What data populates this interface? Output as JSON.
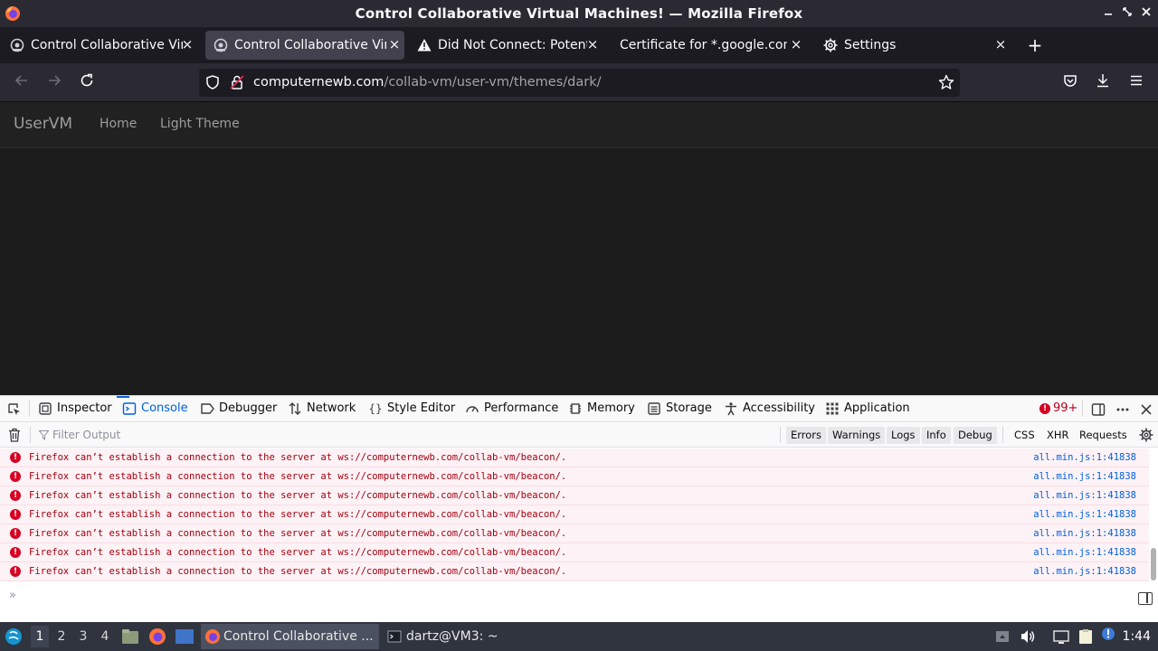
{
  "window": {
    "title": "Control Collaborative Virtual Machines! — Mozilla Firefox",
    "controls": [
      "minimize",
      "maximize",
      "close"
    ]
  },
  "tabs": [
    {
      "label": "Control Collaborative Virtual Machines!",
      "icon": "vm-favicon-icon",
      "selected": false
    },
    {
      "label": "Control Collaborative Virtual Machines!",
      "icon": "vm-favicon-icon",
      "selected": true
    },
    {
      "label": "Did Not Connect: Potential Security Issue",
      "icon": "warning-icon",
      "selected": false
    },
    {
      "label": "Certificate for *.google.com",
      "icon": "none",
      "selected": false
    },
    {
      "label": "Settings",
      "icon": "gear-icon",
      "selected": false
    }
  ],
  "navbar": {
    "url_host": "computernewb.com",
    "url_path": "/collab-vm/user-vm/themes/dark/"
  },
  "site": {
    "brand": "UserVM",
    "links": [
      "Home",
      "Light Theme"
    ]
  },
  "devtools": {
    "tabs": [
      {
        "label": "Inspector",
        "icon": "inspector-icon"
      },
      {
        "label": "Console",
        "icon": "console-icon",
        "active": true
      },
      {
        "label": "Debugger",
        "icon": "debugger-icon"
      },
      {
        "label": "Network",
        "icon": "network-icon"
      },
      {
        "label": "Style Editor",
        "icon": "style-editor-icon"
      },
      {
        "label": "Performance",
        "icon": "performance-icon"
      },
      {
        "label": "Memory",
        "icon": "memory-icon"
      },
      {
        "label": "Storage",
        "icon": "storage-icon"
      },
      {
        "label": "Accessibility",
        "icon": "accessibility-icon"
      },
      {
        "label": "Application",
        "icon": "application-icon"
      }
    ],
    "error_count": "99+",
    "filter_placeholder": "Filter Output",
    "level_filters": [
      "Errors",
      "Warnings",
      "Logs",
      "Info",
      "Debug"
    ],
    "type_filters": [
      "CSS",
      "XHR",
      "Requests"
    ],
    "messages": [
      {
        "text": "Firefox can’t establish a connection to the server at ws://computernewb.com/collab-vm/beacon/.",
        "source": "all.min.js:1:41838"
      },
      {
        "text": "Firefox can’t establish a connection to the server at ws://computernewb.com/collab-vm/beacon/.",
        "source": "all.min.js:1:41838"
      },
      {
        "text": "Firefox can’t establish a connection to the server at ws://computernewb.com/collab-vm/beacon/.",
        "source": "all.min.js:1:41838"
      },
      {
        "text": "Firefox can’t establish a connection to the server at ws://computernewb.com/collab-vm/beacon/.",
        "source": "all.min.js:1:41838"
      },
      {
        "text": "Firefox can’t establish a connection to the server at ws://computernewb.com/collab-vm/beacon/.",
        "source": "all.min.js:1:41838"
      },
      {
        "text": "Firefox can’t establish a connection to the server at ws://computernewb.com/collab-vm/beacon/.",
        "source": "all.min.js:1:41838"
      },
      {
        "text": "Firefox can’t establish a connection to the server at ws://computernewb.com/collab-vm/beacon/.",
        "source": "all.min.js:1:41838"
      }
    ],
    "prompt": "»"
  },
  "taskbar": {
    "workspaces": [
      "1",
      "2",
      "3",
      "4"
    ],
    "active_workspace": "1",
    "tasks": [
      {
        "label": "Control Collaborative ...",
        "icon": "firefox-icon",
        "active": true
      },
      {
        "label": "dartz@VM3: ~",
        "icon": "terminal-icon",
        "active": false
      }
    ],
    "clock": "1:44"
  },
  "colors": {
    "accent": "#0060df",
    "error": "#d70022",
    "chrome_dark": "#2b2a33",
    "page_bg": "#1b1b1b"
  }
}
